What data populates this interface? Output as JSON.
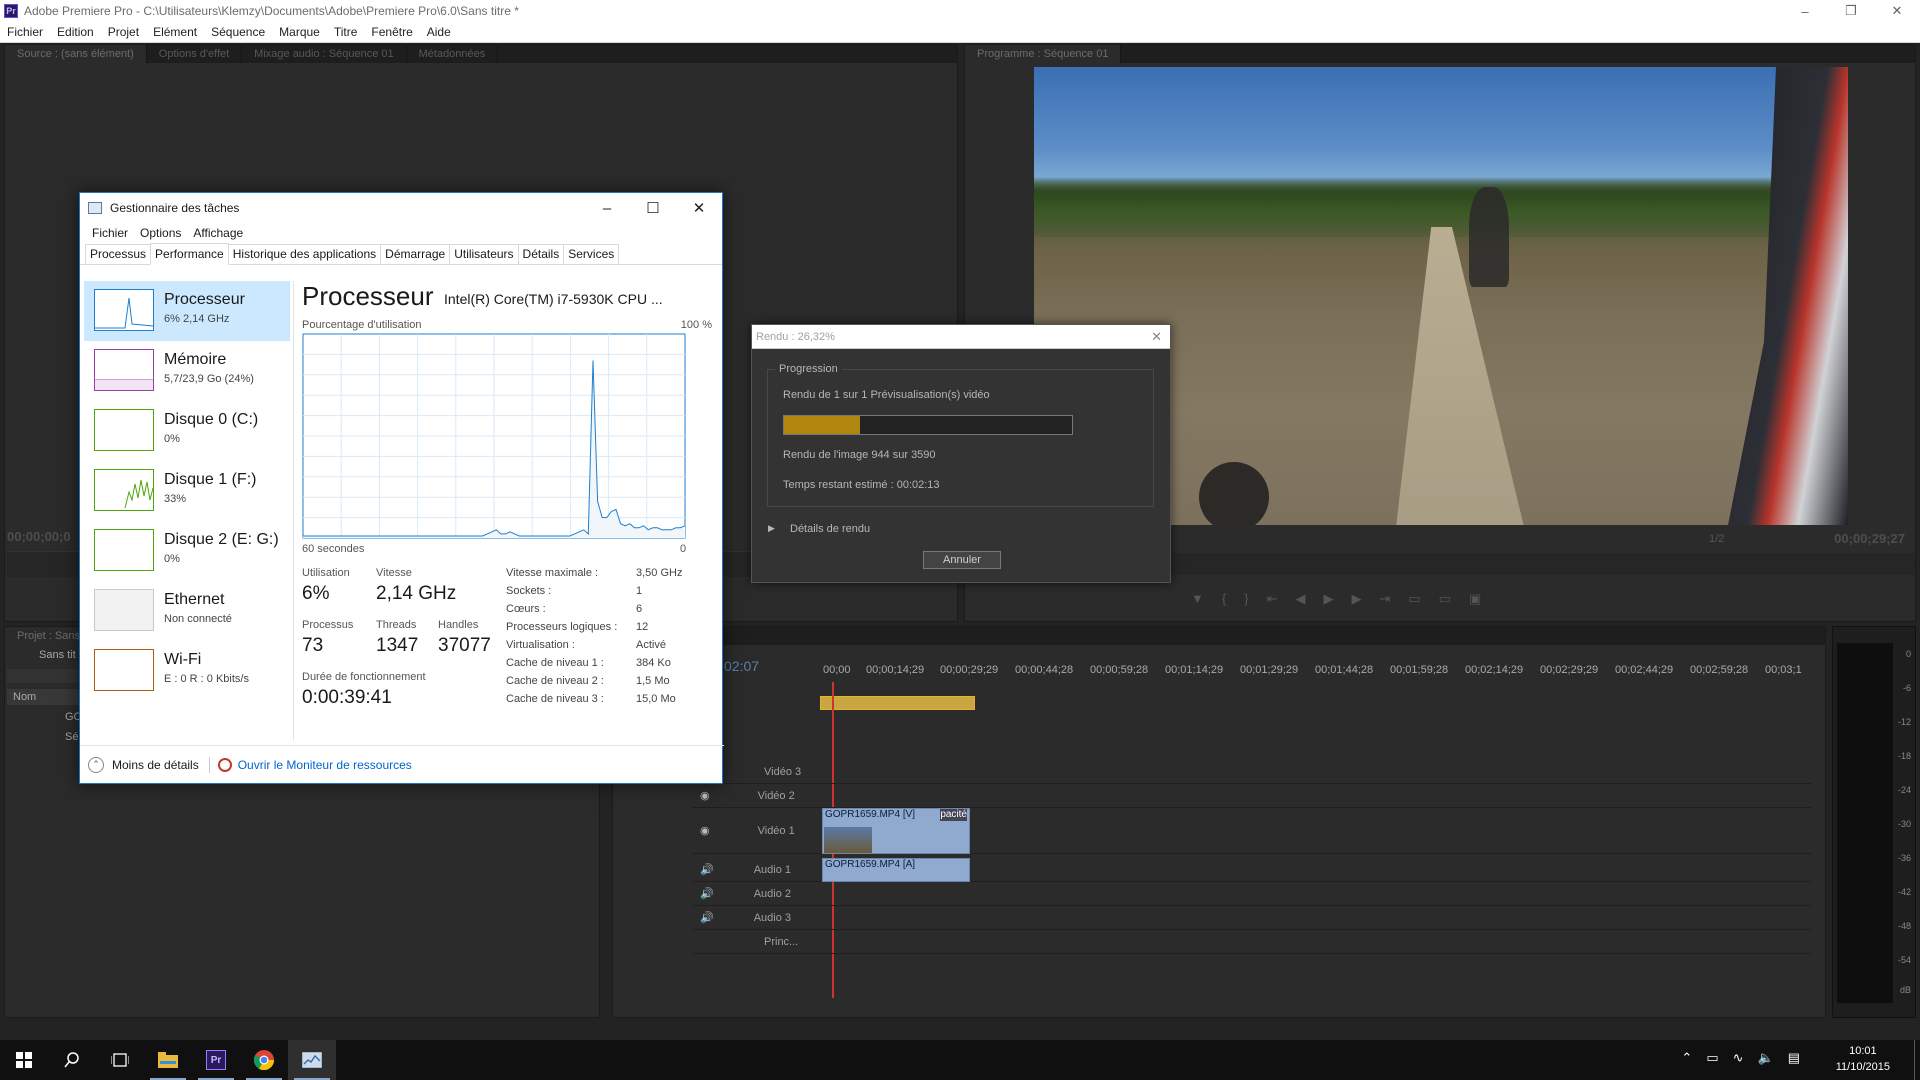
{
  "premiere": {
    "title": "Adobe Premiere Pro - C:\\Utilisateurs\\Klemzy\\Documents\\Adobe\\Premiere Pro\\6.0\\Sans titre *",
    "logo": "Pr",
    "menu": [
      "Fichier",
      "Edition",
      "Projet",
      "Elément",
      "Séquence",
      "Marque",
      "Titre",
      "Fenêtre",
      "Aide"
    ],
    "source_tabs": [
      "Source : (sans élément)",
      "Options d'effet",
      "Mixage audio : Séquence 01",
      "Métadonnées"
    ],
    "program_tab": "Programme : Séquence 01",
    "source_timecode": "00;00;00;0",
    "program_timecode": "00;00;29;27",
    "zoom": "1/2",
    "project_tab": "Projet : Sans",
    "project_name": "Sans tit",
    "project_col": "Nom",
    "project_items": [
      "GO",
      "Séq"
    ],
    "timeline_timecode": "02:07",
    "ruler": [
      "00;00",
      "00;00;14;29",
      "00;00;29;29",
      "00;00;44;28",
      "00;00;59;28",
      "00;01;14;29",
      "00;01;29;29",
      "00;01;44;28",
      "00;01;59;28",
      "00;02;14;29",
      "00;02;29;29",
      "00;02;44;29",
      "00;02;59;28",
      "00;03;1"
    ],
    "tracks": {
      "v3": "Vidéo 3",
      "v2": "Vidéo 2",
      "v1": "Vidéo 1",
      "a1": "Audio 1",
      "a2": "Audio 2",
      "a3": "Audio 3",
      "master": "Princ..."
    },
    "clip_video": "GOPR1659.MP4 [V]",
    "clip_opacity": "pacité",
    "clip_audio": "GOPR1659.MP4 [A]",
    "meter_labels": [
      "0",
      "-6",
      "-12",
      "-18",
      "-24",
      "-30",
      "-36",
      "-42",
      "-48",
      "-54",
      "dB"
    ]
  },
  "task_manager": {
    "title": "Gestionnaire des tâches",
    "menu": [
      "Fichier",
      "Options",
      "Affichage"
    ],
    "tabs": [
      "Processus",
      "Performance",
      "Historique des applications",
      "Démarrage",
      "Utilisateurs",
      "Détails",
      "Services"
    ],
    "active_tab": "Performance",
    "side_items": [
      {
        "name": "Processeur",
        "sub": "6% 2,14 GHz",
        "color": "#1f7fcf"
      },
      {
        "name": "Mémoire",
        "sub": "5,7/23,9 Go (24%)",
        "color": "#9b3fa8"
      },
      {
        "name": "Disque 0 (C:)",
        "sub": "0%",
        "color": "#4da60c"
      },
      {
        "name": "Disque 1 (F:)",
        "sub": "33%",
        "color": "#4da60c"
      },
      {
        "name": "Disque 2 (E: G:)",
        "sub": "0%",
        "color": "#4da60c"
      },
      {
        "name": "Ethernet",
        "sub": "Non connecté",
        "color": "#c9c9c9"
      },
      {
        "name": "Wi-Fi",
        "sub": "E : 0 R : 0 Kbits/s",
        "color": "#a75d14"
      }
    ],
    "cpu_title": "Processeur",
    "cpu_model": "Intel(R) Core(TM) i7-5930K CPU ...",
    "graph_label": "Pourcentage d'utilisation",
    "graph_max": "100 %",
    "graph_xlabel": "60 secondes",
    "graph_xmin": "0",
    "graph_series": [
      1,
      1,
      1,
      1,
      1,
      1,
      1,
      1,
      1,
      1,
      1,
      1,
      1,
      1,
      1,
      1,
      1,
      1,
      1,
      1,
      1,
      1,
      1,
      1,
      1,
      1,
      1,
      1,
      1,
      1,
      1,
      1,
      1,
      1,
      1,
      1,
      1,
      1,
      1,
      1,
      2,
      3,
      4,
      2,
      2,
      3,
      2,
      1,
      1,
      1,
      1,
      1,
      1,
      1,
      1,
      1,
      1,
      1,
      1,
      2,
      3,
      4,
      2,
      87,
      18,
      10,
      10,
      13,
      14,
      7,
      6,
      7,
      5,
      5,
      6,
      4,
      5,
      5,
      4,
      4,
      4,
      5,
      5,
      6
    ],
    "stats": {
      "util_label": "Utilisation",
      "util_val": "6%",
      "speed_label": "Vitesse",
      "speed_val": "2,14 GHz",
      "proc_label": "Processus",
      "proc_val": "73",
      "threads_label": "Threads",
      "threads_val": "1347",
      "handles_label": "Handles",
      "handles_val": "37077",
      "uptime_label": "Durée de fonctionnement",
      "uptime_val": "0:00:39:41"
    },
    "details": [
      {
        "k": "Vitesse maximale :",
        "v": "3,50 GHz"
      },
      {
        "k": "Sockets :",
        "v": "1"
      },
      {
        "k": "Cœurs :",
        "v": "6"
      },
      {
        "k": "Processeurs logiques :",
        "v": "12"
      },
      {
        "k": "Virtualisation :",
        "v": "Activé"
      },
      {
        "k": "Cache de niveau 1 :",
        "v": "384 Ko"
      },
      {
        "k": "Cache de niveau 2 :",
        "v": "1,5 Mo"
      },
      {
        "k": "Cache de niveau 3 :",
        "v": "15,0 Mo"
      }
    ],
    "less_details": "Moins de détails",
    "resource_monitor": "Ouvrir le Moniteur de ressources"
  },
  "render_dialog": {
    "title": "Rendu : 26,32%",
    "group": "Progression",
    "line1": "Rendu de 1 sur 1 Prévisualisation(s) vidéo",
    "progress_fraction": 0.2632,
    "line2": "Rendu de l'image 944 sur 3590",
    "line3": "Temps restant estimé : 00:02:13",
    "details": "Détails de rendu",
    "cancel": "Annuler"
  },
  "taskbar": {
    "time": "10:01",
    "date": "11/10/2015"
  }
}
